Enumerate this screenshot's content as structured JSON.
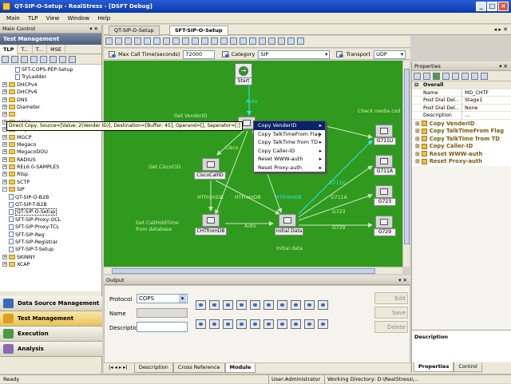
{
  "window": {
    "title": "QT-SIP-O-Setup - RealStress - [DSFT Debug]"
  },
  "menu": [
    "Main",
    "TLP",
    "View",
    "Window",
    "Help"
  ],
  "main_control": {
    "title": "Main Control",
    "pin": "▾ ✕"
  },
  "test_mgmt": {
    "title": "Test Management",
    "tabs": [
      "TLP",
      "T...",
      "T...",
      "MSE"
    ]
  },
  "tree": [
    {
      "label": "SFT-COPS-PEP-Setup",
      "depth": 2,
      "type": "doc"
    },
    {
      "label": "TryLadder",
      "depth": 2,
      "type": "doc"
    },
    {
      "label": "DHCPv4",
      "depth": 0,
      "type": "folder"
    },
    {
      "label": "DHCPv6",
      "depth": 0,
      "type": "folder"
    },
    {
      "label": "DNS",
      "depth": 0,
      "type": "folder"
    },
    {
      "label": "Diameter",
      "depth": 0,
      "type": "folder"
    },
    {
      "label": "",
      "depth": 0,
      "type": "folder"
    },
    {
      "label": "H323",
      "depth": 0,
      "type": "folder"
    },
    {
      "label": "Http",
      "depth": 0,
      "type": "folder"
    },
    {
      "label": "MGCP",
      "depth": 0,
      "type": "folder"
    },
    {
      "label": "Megaco",
      "depth": 0,
      "type": "folder"
    },
    {
      "label": "MegacoDOU",
      "depth": 0,
      "type": "folder"
    },
    {
      "label": "RADIUS",
      "depth": 0,
      "type": "folder"
    },
    {
      "label": "REL6.0-SAMPLES",
      "depth": 0,
      "type": "folder"
    },
    {
      "label": "Rtsp",
      "depth": 0,
      "type": "folder"
    },
    {
      "label": "SCTP",
      "depth": 0,
      "type": "folder"
    },
    {
      "label": "SIP",
      "depth": 0,
      "type": "folder-open"
    },
    {
      "label": "QT-SIP-O-B2B",
      "depth": 1,
      "type": "doc"
    },
    {
      "label": "QT-SIP-T-B2B",
      "depth": 1,
      "type": "doc"
    },
    {
      "label": "QT-SIP-O-Setup",
      "depth": 1,
      "type": "doc",
      "selected": true
    },
    {
      "label": "SFT-SIP-Proxy-OCL",
      "depth": 1,
      "type": "doc"
    },
    {
      "label": "SFT-SIP-Proxy-TCL",
      "depth": 1,
      "type": "doc"
    },
    {
      "label": "SFT-SIP-Reg",
      "depth": 1,
      "type": "doc"
    },
    {
      "label": "SFT-SIP-Registrar",
      "depth": 1,
      "type": "doc"
    },
    {
      "label": "SFT-SIP-T-Setup",
      "depth": 1,
      "type": "doc"
    },
    {
      "label": "SKINNY",
      "depth": 0,
      "type": "folder"
    },
    {
      "label": "XCAP",
      "depth": 0,
      "type": "folder"
    }
  ],
  "nav": [
    {
      "label": "Data Source Management",
      "color": "#3a6bb8"
    },
    {
      "label": "Test Management",
      "color": "#d8a020",
      "selected": true
    },
    {
      "label": "Execution",
      "color": "#4a9a40"
    },
    {
      "label": "Analysis",
      "color": "#8a6ab0"
    }
  ],
  "doc_tabs": [
    {
      "label": "QT-SIP-O-Setup",
      "active": false
    },
    {
      "label": "SFT-SIP-O-Setup",
      "active": true
    }
  ],
  "doc_tab_nav": "◂ ▸ ✕",
  "params": {
    "max_call_time_label": "Max Call Time(seconds)",
    "max_call_time_value": "72000",
    "category_label": "Category",
    "category_value": "SIP",
    "transport_label": "Transport",
    "transport_value": "UDP"
  },
  "canvas": {
    "nodes": [
      {
        "id": "start",
        "label": "Start"
      },
      {
        "id": "ciscocallid",
        "label": "CiscoCallID"
      },
      {
        "id": "chtfromdb",
        "label": "CHTfromDB"
      },
      {
        "id": "initialdata",
        "label": "Initial Data"
      },
      {
        "id": "g711u",
        "label": "G711U"
      },
      {
        "id": "g711a",
        "label": "G711A"
      },
      {
        "id": "g723",
        "label": "G723"
      },
      {
        "id": "g729",
        "label": "G729"
      }
    ],
    "labels": {
      "get_vender_id": "Get VenderID",
      "get_cisco_cid": "Get CiscoCID",
      "get_call_hold_time": "Get CallHoldTime",
      "from_database": "from database",
      "check_media": "Check media cod",
      "auto1": "Auto",
      "cisco": "Cisco",
      "htfromdb1": "HTFromDB",
      "htfromdb2": "HTFromDB",
      "htfromdb3": "HTFromDB",
      "auto2": "Auto",
      "g711u": "G711U",
      "g711a": "G711A",
      "g723": "G723",
      "g729": "G729",
      "initial_data": "Initial data"
    }
  },
  "tooltip": "Direct Copy, Source=[Value: 2(Vender ID)], Destination=[Buffer: 45], Operand=[], Seperator=[;]",
  "context_menu": [
    {
      "label": "Copy VenderID",
      "highlight": true
    },
    {
      "label": "Copy TalkTimeFrom Flag"
    },
    {
      "label": "Copy TalkTime from TD"
    },
    {
      "label": "Copy Caller-ID"
    },
    {
      "label": "Reset WWW-auth"
    },
    {
      "label": "Reset Proxy-auth"
    }
  ],
  "context_menu_arrow": "▸",
  "properties": {
    "title": "Properties",
    "pin": "▾ ✕",
    "section": "Overall",
    "fields": [
      {
        "key": "Name",
        "value": "MD_CHTF"
      },
      {
        "key": "Post Dial Del...",
        "value": "Stage1"
      },
      {
        "key": "Post Dial Del...",
        "value": "None"
      },
      {
        "key": "Description",
        "value": "..."
      }
    ],
    "items": [
      "Copy VenderID",
      "Copy TalkTimeFrom Flag",
      "Copy TalkTime from TD",
      "Copy Caller-ID",
      "Reset WWW-auth",
      "Reset Proxy-auth"
    ],
    "description_label": "Description",
    "tabs": [
      "Properties",
      "Control"
    ]
  },
  "output": {
    "title": "Output",
    "pin": "▾ ✕",
    "protocol_label": "Protocol",
    "protocol_value": "COPS",
    "name_label": "Name",
    "description_label": "Description",
    "buttons": [
      "Edit",
      "Save",
      "Delete"
    ]
  },
  "bottom_tabs": [
    {
      "label": "Description"
    },
    {
      "label": "Cross Reference"
    },
    {
      "label": "Module",
      "active": true
    }
  ],
  "tab_nav": "|◂ ◂ ▸ ▸|",
  "status": {
    "ready": "Ready",
    "user": "User:Administrator",
    "working_dir": "Working Directory: D:\\RealStress\\..."
  }
}
